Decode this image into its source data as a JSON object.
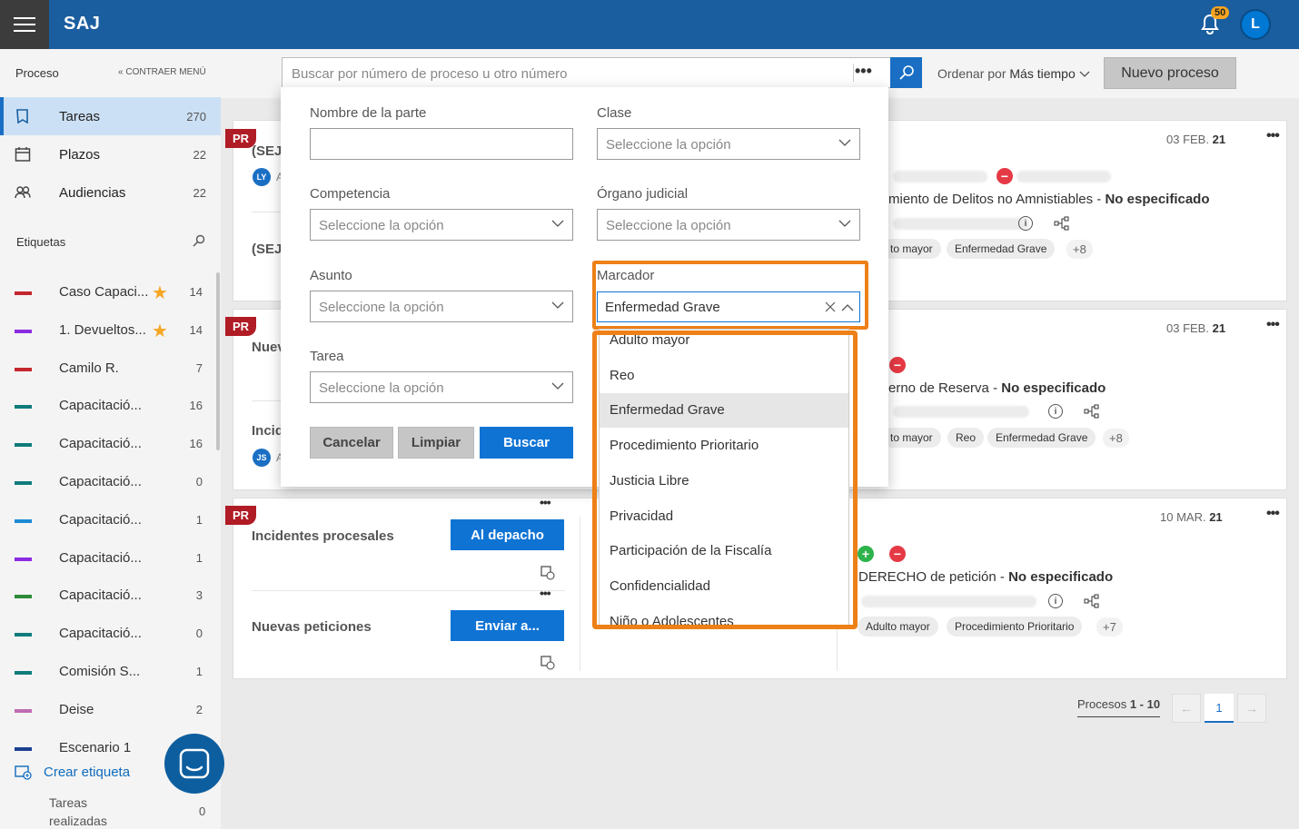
{
  "app": {
    "title": "SAJ",
    "notifications": "50",
    "user_initial": "L"
  },
  "sidebar": {
    "section": "Proceso",
    "collapse": "CONTRAER MENÚ",
    "nav": [
      {
        "label": "Tareas",
        "count": "270"
      },
      {
        "label": "Plazos",
        "count": "22"
      },
      {
        "label": "Audiencias",
        "count": "22"
      }
    ],
    "tags_title": "Etiquetas",
    "tags": [
      {
        "label": "Caso Capaci...",
        "count": "14",
        "color": "#c4262e",
        "star": true
      },
      {
        "label": "1. Devueltos...",
        "count": "14",
        "color": "#8a2be2",
        "star": true
      },
      {
        "label": "Camilo R.",
        "count": "7",
        "color": "#c4262e",
        "star": false
      },
      {
        "label": "Capacitació...",
        "count": "16",
        "color": "#0f7b7b",
        "star": false
      },
      {
        "label": "Capacitació...",
        "count": "16",
        "color": "#0f7b7b",
        "star": false
      },
      {
        "label": "Capacitació...",
        "count": "0",
        "color": "#0f7b7b",
        "star": false
      },
      {
        "label": "Capacitació...",
        "count": "1",
        "color": "#1a8ad4",
        "star": false
      },
      {
        "label": "Capacitació...",
        "count": "1",
        "color": "#8a2be2",
        "star": false
      },
      {
        "label": "Capacitació...",
        "count": "3",
        "color": "#2d8a3a",
        "star": false
      },
      {
        "label": "Capacitació...",
        "count": "0",
        "color": "#0f7b7b",
        "star": false
      },
      {
        "label": "Comisión S...",
        "count": "1",
        "color": "#0f7b7b",
        "star": false
      },
      {
        "label": "Deise",
        "count": "2",
        "color": "#c06bb3",
        "star": false
      },
      {
        "label": "Escenario 1",
        "count": "",
        "color": "#1a3f8f",
        "star": false
      }
    ],
    "create_tag": "Crear etiqueta",
    "done_tasks": "Tareas realizadas",
    "done_count": "0"
  },
  "toolbar": {
    "search_placeholder": "Buscar por número de proceso u otro número",
    "more": "•••",
    "order_label": "Ordenar por",
    "order_value": "Más tiempo",
    "new_process": "Nuevo proceso"
  },
  "cards": {
    "pr": "PR",
    "c1": {
      "date_day": "03 FEB.",
      "date_year": "21",
      "text": "miento de Delitos no Amnistiables",
      "status": "No especificado",
      "chips": [
        "to mayor",
        "Enfermedad Grave"
      ],
      "more": "+8",
      "left1": "(SEJU",
      "left1_av": "LY",
      "left1_sub": "A",
      "left2": "(SEJU"
    },
    "c2": {
      "date_day": "03 FEB.",
      "date_year": "21",
      "text": "erno de Reserva",
      "status": "No especificado",
      "chips": [
        "to mayor",
        "Reo",
        "Enfermedad Grave"
      ],
      "more": "+8",
      "left1": "Nuev",
      "left2": "Incid",
      "left2_av": "JS",
      "left2_sub": "A"
    },
    "c3": {
      "date_day": "10 MAR.",
      "date_year": "21",
      "text": "DERECHO de petición",
      "status": "No especificado",
      "chips": [
        "Adulto mayor",
        "Procedimiento Prioritario"
      ],
      "more": "+7",
      "row1_label": "Incidentes procesales",
      "row1_btn": "Al depacho",
      "row2_label": "Nuevas peticiones",
      "row2_btn": "Enviar a..."
    }
  },
  "pagination": {
    "label": "Procesos",
    "range": "1 - 10",
    "current": "1"
  },
  "modal": {
    "fields": {
      "parte": "Nombre de la parte",
      "clase": "Clase",
      "competencia": "Competencia",
      "organo": "Órgano judicial",
      "asunto": "Asunto",
      "marcador": "Marcador",
      "tarea": "Tarea"
    },
    "placeholder": "Seleccione la opción",
    "marcador_value": "Enfermedad Grave",
    "options": [
      "Adulto mayor",
      "Reo",
      "Enfermedad Grave",
      "Procedimiento Prioritario",
      "Justicia Libre",
      "Privacidad",
      "Participación de la Fiscalía",
      "Confidencialidad",
      "Niño o Adolescentes"
    ],
    "selected_option": "Enfermedad Grave",
    "buttons": {
      "cancel": "Cancelar",
      "clear": "Limpiar",
      "search": "Buscar"
    }
  },
  "colors": {
    "accent": "#1a5ea0",
    "primary_button": "#0f73d4",
    "highlight": "#ed8017",
    "pr_badge": "#b01c25"
  }
}
